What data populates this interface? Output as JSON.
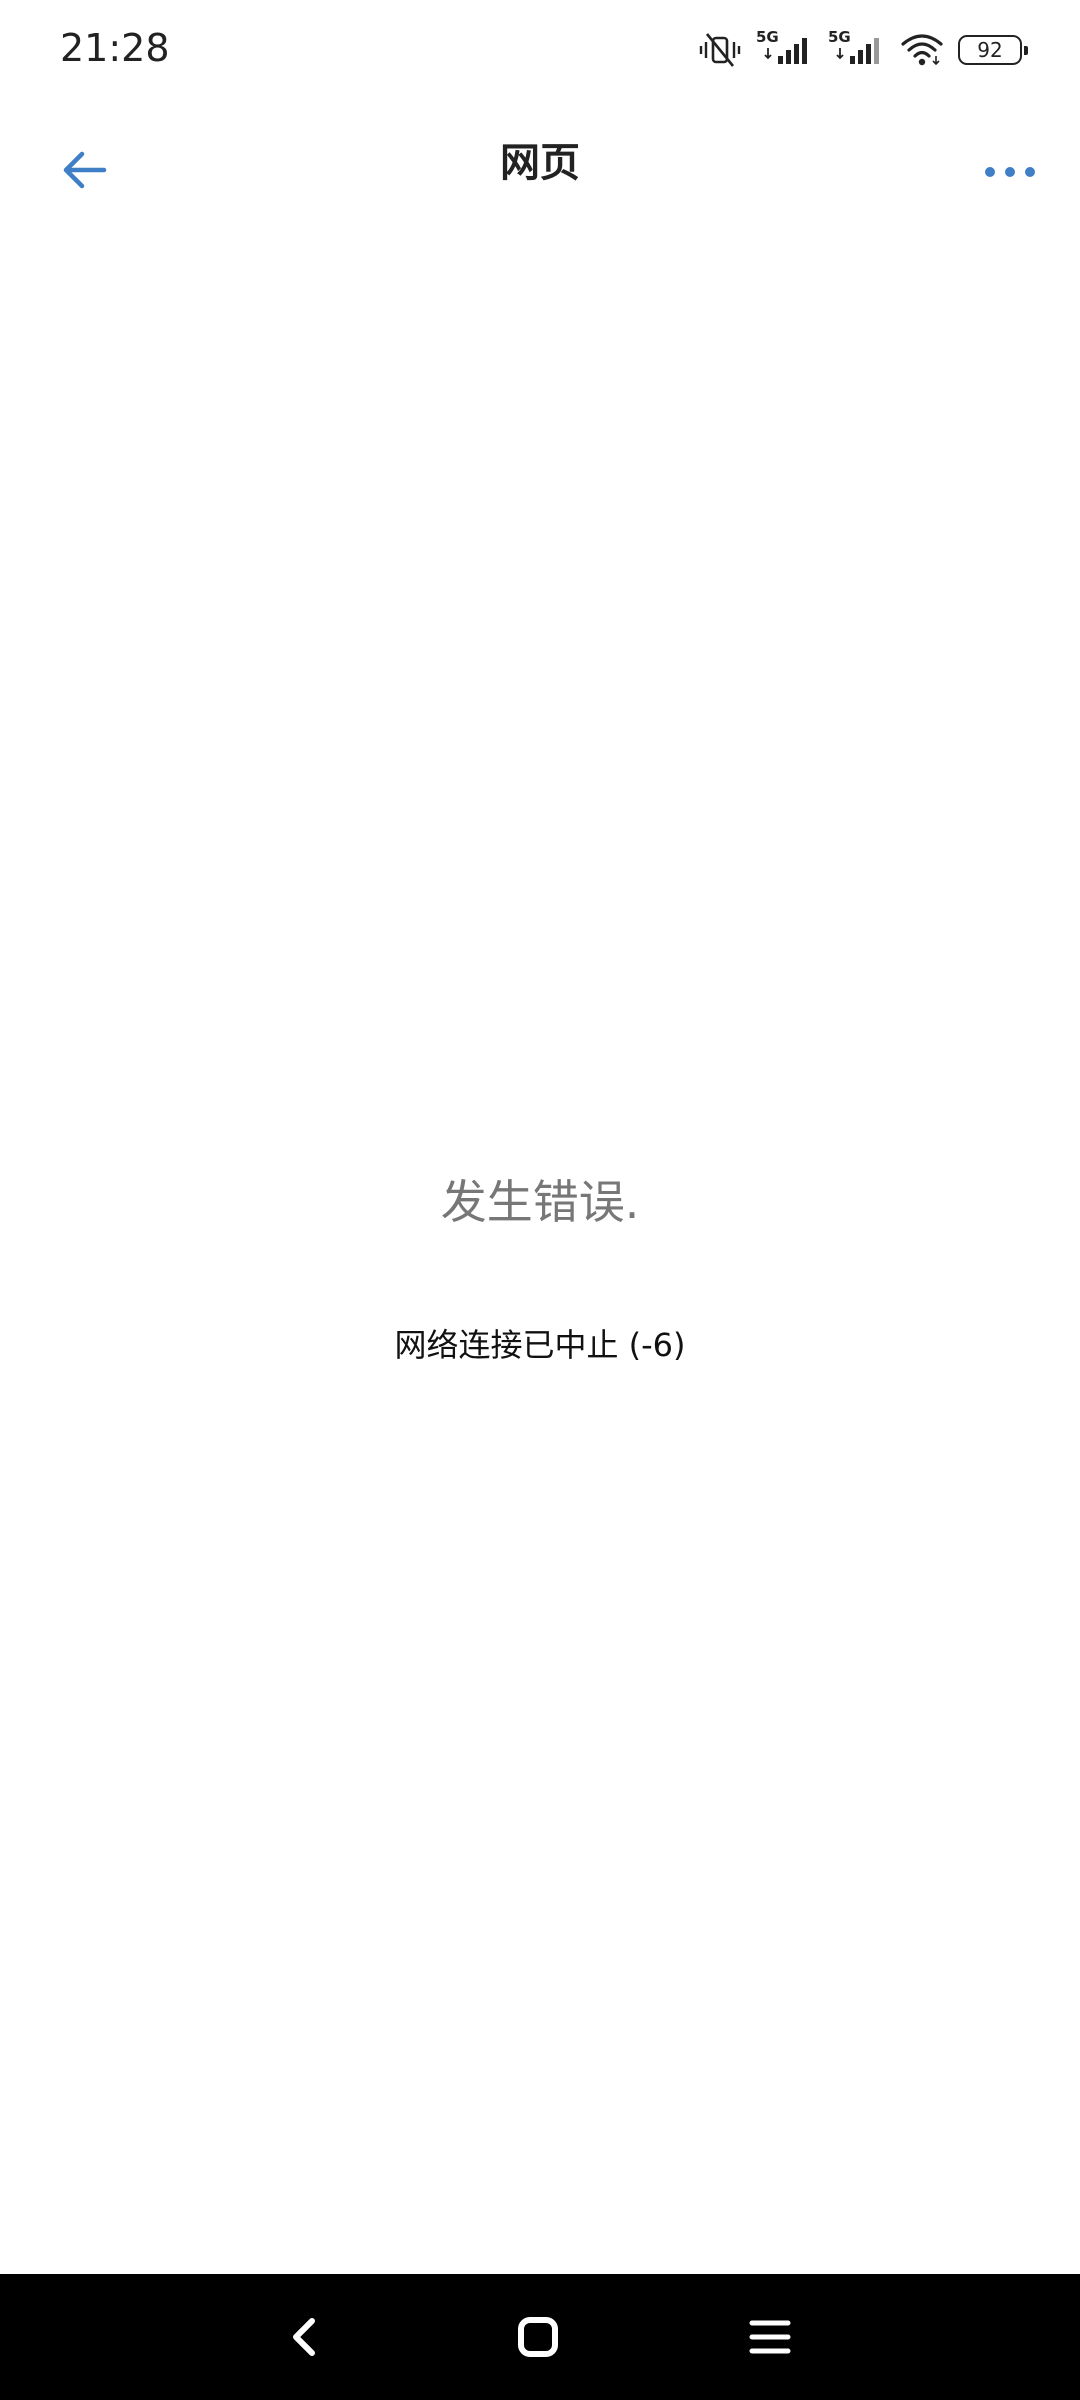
{
  "status_bar": {
    "time": "21:28",
    "network_1": "5G",
    "network_2": "5G",
    "battery_level": "92",
    "icons": [
      "vibrate-off-icon",
      "signal-5g-icon",
      "signal-5g-icon",
      "wifi-icon",
      "battery-icon"
    ]
  },
  "title_bar": {
    "title": "网页",
    "back_icon": "arrow-left-icon",
    "more_icon": "more-dots-icon",
    "accent_color": "#3f7fc6"
  },
  "error": {
    "heading": "发生错误.",
    "detail": "网络连接已中止 (-6)"
  },
  "nav_bar": {
    "icons": [
      "back-chevron-icon",
      "home-square-icon",
      "menu-lines-icon"
    ]
  }
}
